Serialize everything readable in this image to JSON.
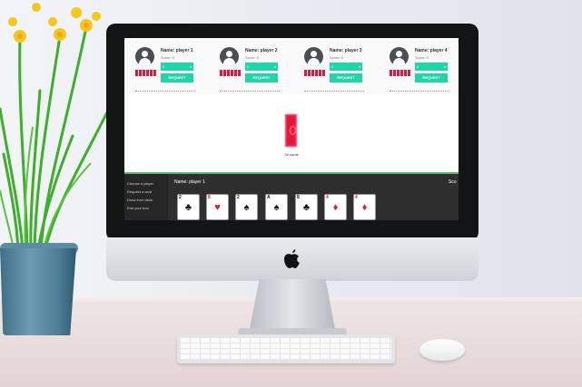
{
  "players": [
    {
      "name": "Name:  player 1",
      "score": "Score:  0",
      "select_value": "2",
      "request_label": "REQUEST"
    },
    {
      "name": "Name:  player 2",
      "score": "Score:  0",
      "select_value": "2",
      "request_label": "REQUEST"
    },
    {
      "name": "Name:  player 3",
      "score": "Score:  0",
      "select_value": "2",
      "request_label": "REQUEST"
    },
    {
      "name": "Name:  player 4",
      "score": "Score:  0",
      "select_value": "2",
      "request_label": "REQUEST"
    }
  ],
  "deck": {
    "count_label": "34 cards"
  },
  "menu": {
    "choose_player": "Choose a player",
    "request_card": "Request a card",
    "draw_from_deck": "Draw from deck",
    "end_turn": "End your turn"
  },
  "hand": {
    "player_name": "Name:  player 1",
    "score_label": "Sco",
    "cards": [
      {
        "rank": "2",
        "suit": "♣",
        "color": "black"
      },
      {
        "rank": "8",
        "suit": "♥",
        "color": "red"
      },
      {
        "rank": "2",
        "suit": "♠",
        "color": "black"
      },
      {
        "rank": "A",
        "suit": "♠",
        "color": "black"
      },
      {
        "rank": "8",
        "suit": "♣",
        "color": "black"
      },
      {
        "rank": "4",
        "suit": "♦",
        "color": "red"
      },
      {
        "rank": "4",
        "suit": "♦",
        "color": "red"
      }
    ]
  },
  "colors": {
    "accent": "#1ed6a7",
    "card_back": "#e3163d",
    "divider": "#5cb85c"
  },
  "icons": {
    "avatar": "user-avatar-icon",
    "apple": "apple-logo-icon"
  }
}
